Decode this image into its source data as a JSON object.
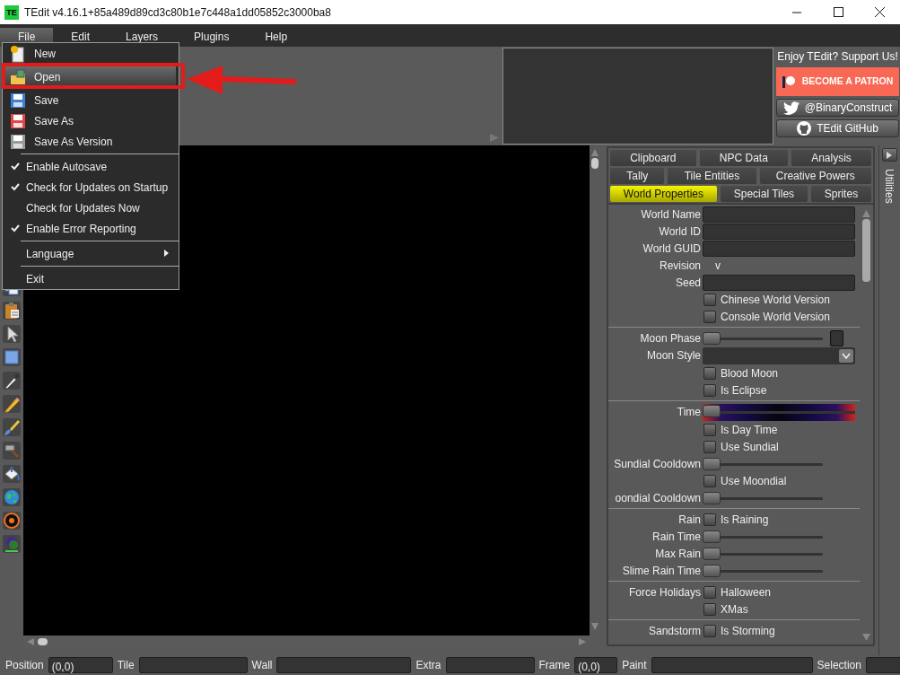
{
  "window": {
    "logo": "TE",
    "title": "TEdit v4.16.1+85a489d89cd3c80b1e7c448a1dd05852c3000ba8"
  },
  "menu_bar": [
    {
      "label": "File",
      "open": true
    },
    {
      "label": "Edit",
      "open": false
    },
    {
      "label": "Layers",
      "open": false
    },
    {
      "label": "Plugins",
      "open": false
    },
    {
      "label": "Help",
      "open": false
    }
  ],
  "file_menu": {
    "items": [
      {
        "kind": "command",
        "label": "New",
        "highlighted": false
      },
      {
        "kind": "command",
        "label": "Open",
        "highlighted": true
      },
      {
        "kind": "command",
        "label": "Save",
        "highlighted": false
      },
      {
        "kind": "command",
        "label": "Save As",
        "highlighted": false
      },
      {
        "kind": "command",
        "label": "Save As Version",
        "highlighted": false
      },
      {
        "kind": "separator"
      },
      {
        "kind": "toggle",
        "label": "Enable Autosave",
        "checked": true,
        "highlighted": false
      },
      {
        "kind": "toggle",
        "label": "Check for Updates on Startup",
        "checked": true,
        "highlighted": false
      },
      {
        "kind": "toggle",
        "label": "Check for Updates Now",
        "checked": false,
        "highlighted": false
      },
      {
        "kind": "toggle",
        "label": "Enable Error Reporting",
        "checked": true,
        "highlighted": false
      },
      {
        "kind": "separator"
      },
      {
        "kind": "submenu",
        "label": "Language",
        "highlighted": false
      },
      {
        "kind": "separator"
      },
      {
        "kind": "toggle",
        "label": "Exit",
        "checked": false,
        "highlighted": false
      }
    ]
  },
  "support": {
    "heading": "Enjoy TEdit? Support Us!",
    "buttons": [
      {
        "kind": "patreon",
        "label": "BECOME A PATRON"
      },
      {
        "kind": "twitter",
        "label": "@BinaryConstruct"
      },
      {
        "kind": "github",
        "label": "TEdit GitHub"
      }
    ]
  },
  "panel": {
    "tab_rows": [
      {
        "tabs": [
          {
            "label": "Clipboard",
            "selected": false
          },
          {
            "label": "NPC Data",
            "selected": false
          },
          {
            "label": "Analysis",
            "selected": false
          }
        ]
      },
      {
        "tabs": [
          {
            "label": "Tally",
            "selected": false
          },
          {
            "label": "Tile Entities",
            "selected": false
          },
          {
            "label": "Creative Powers",
            "selected": false
          }
        ]
      },
      {
        "tabs": [
          {
            "label": "World Properties",
            "selected": true
          },
          {
            "label": "Special Tiles",
            "selected": false
          },
          {
            "label": "Sprites",
            "selected": false
          }
        ]
      }
    ],
    "properties": [
      {
        "kind": "text",
        "label": "World Name"
      },
      {
        "kind": "text",
        "label": "World ID"
      },
      {
        "kind": "text",
        "label": "World GUID"
      },
      {
        "kind": "value",
        "label": "Revision",
        "value": "v"
      },
      {
        "kind": "text",
        "label": "Seed"
      },
      {
        "kind": "check",
        "caption": "Chinese World Version",
        "checked": false
      },
      {
        "kind": "check",
        "caption": "Console World Version",
        "checked": false
      },
      {
        "kind": "divider"
      },
      {
        "kind": "slider",
        "label": "Moon Phase",
        "level": 0,
        "swatch": true
      },
      {
        "kind": "dropdown",
        "label": "Moon Style"
      },
      {
        "kind": "check",
        "caption": "Blood Moon",
        "checked": false
      },
      {
        "kind": "check",
        "caption": "Is Eclipse",
        "checked": false
      },
      {
        "kind": "divider"
      },
      {
        "kind": "time",
        "label": "Time",
        "level": 0
      },
      {
        "kind": "check",
        "caption": "Is Day Time",
        "checked": false
      },
      {
        "kind": "check",
        "caption": "Use Sundial",
        "checked": false
      },
      {
        "kind": "slider",
        "label": "Sundial Cooldown",
        "level": 0
      },
      {
        "kind": "check",
        "caption": "Use Moondial",
        "checked": false
      },
      {
        "kind": "slider",
        "label": "oondial Cooldown",
        "level": 0
      },
      {
        "kind": "divider"
      },
      {
        "kind": "check",
        "label": "Rain",
        "caption": "Is Raining",
        "checked": false
      },
      {
        "kind": "slider",
        "label": "Rain Time",
        "level": 0
      },
      {
        "kind": "slider",
        "label": "Max Rain",
        "level": 0
      },
      {
        "kind": "slider",
        "label": "Slime Rain Time",
        "level": 0
      },
      {
        "kind": "divider"
      },
      {
        "kind": "check",
        "label": "Force Holidays",
        "caption": "Halloween",
        "checked": false
      },
      {
        "kind": "check",
        "caption": "XMas",
        "checked": false
      },
      {
        "kind": "divider"
      },
      {
        "kind": "check",
        "label": "Sandstorm",
        "caption": "Is Storming",
        "checked": false
      }
    ]
  },
  "side_tab": {
    "label": "Utilities"
  },
  "status_bar": {
    "items": [
      {
        "label": "Position",
        "value": "(0,0)"
      },
      {
        "label": "Tile"
      },
      {
        "label": "Wall"
      },
      {
        "label": "Extra"
      },
      {
        "label": "Frame",
        "value": "(0,0)"
      },
      {
        "label": "Paint"
      },
      {
        "label": "Selection"
      }
    ]
  }
}
